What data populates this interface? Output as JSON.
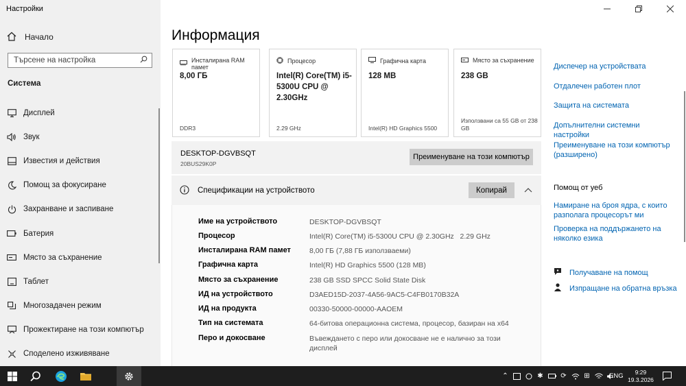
{
  "app": {
    "title": "Настройки"
  },
  "sidebar": {
    "home_label": "Начало",
    "search_placeholder": "Търсене на настройка",
    "section_title": "Система",
    "items": [
      {
        "label": "Дисплей",
        "icon": "monitor-icon"
      },
      {
        "label": "Звук",
        "icon": "speaker-icon"
      },
      {
        "label": "Известия и действия",
        "icon": "notification-icon"
      },
      {
        "label": "Помощ за фокусиране",
        "icon": "moon-icon"
      },
      {
        "label": "Захранване и заспиване",
        "icon": "power-icon"
      },
      {
        "label": "Батерия",
        "icon": "battery-icon"
      },
      {
        "label": "Място за съхранение",
        "icon": "storage-icon"
      },
      {
        "label": "Таблет",
        "icon": "tablet-icon"
      },
      {
        "label": "Многозадачен режим",
        "icon": "multitask-icon"
      },
      {
        "label": "Прожектиране на този компютър",
        "icon": "project-icon"
      },
      {
        "label": "Споделено изживяване",
        "icon": "share-icon"
      }
    ]
  },
  "main": {
    "title": "Информация",
    "cards": [
      {
        "label": "Инсталирана RAM памет",
        "value": "8,00 ГБ",
        "sub": "DDR3",
        "icon": "ram-icon"
      },
      {
        "label": "Процесор",
        "value": "Intel(R) Core(TM) i5-5300U CPU @ 2.30GHz",
        "sub": "2.29 GHz",
        "icon": "cpu-icon"
      },
      {
        "label": "Графична карта",
        "value": "128 MB",
        "sub": "Intel(R) HD Graphics 5500",
        "icon": "gpu-icon"
      },
      {
        "label": "Място за съхранение",
        "value": "238 GB",
        "sub": "Използвани са 55 GB от 238 GB",
        "icon": "storage-icon"
      }
    ],
    "device_name": "DESKTOP-DGVBSQT",
    "device_model": "20BUS29K0P",
    "rename_button": "Преименуване на този компютър",
    "specs_title": "Спецификации на устройството",
    "copy_button": "Копирай",
    "specs": [
      {
        "key": "Име на устройството",
        "value": "DESKTOP-DGVBSQT"
      },
      {
        "key": "Процесор",
        "value": "Intel(R) Core(TM) i5-5300U CPU @ 2.30GHz   2.29 GHz"
      },
      {
        "key": "Инсталирана RAM памет",
        "value": "8,00 ГБ (7,88 ГБ използваеми)"
      },
      {
        "key": "Графична карта",
        "value": "Intel(R) HD Graphics 5500 (128 MB)"
      },
      {
        "key": "Място за съхранение",
        "value": "238 GB SSD SPCC Solid State Disk"
      },
      {
        "key": "ИД на устройството",
        "value": "D3AED15D-2037-4A56-9AC5-C4FB0170B32A"
      },
      {
        "key": "ИД на продукта",
        "value": "00330-50000-00000-AAOEM"
      },
      {
        "key": "Тип на системата",
        "value": "64-битова операционна система, процесор, базиран на x64"
      },
      {
        "key": "Перо и докосване",
        "value": "Въвеждането с перо или докосване не е налично за този дисплей"
      }
    ]
  },
  "related": {
    "links": [
      "Диспечер на устройствата",
      "Отдалечен работен плот",
      "Защита на системата",
      "Допълнителни системни настройки",
      "Преименуване на този компютър (разширено)"
    ],
    "web_help_title": "Помощ от уеб",
    "web_links": [
      "Намиране на броя ядра, с които разполага процесорът ми",
      "Проверка на поддържането на няколко езика"
    ],
    "get_help": "Получаване на помощ",
    "feedback": "Изпращане на обратна връзка"
  },
  "taskbar": {
    "language": "ENG",
    "time": "9:29",
    "date": "19.3.2026 г."
  },
  "colors": {
    "link": "#0063b1",
    "taskbar": "#1e1e1e",
    "sidebar": "#f0f0f0",
    "button": "#cccccc"
  }
}
